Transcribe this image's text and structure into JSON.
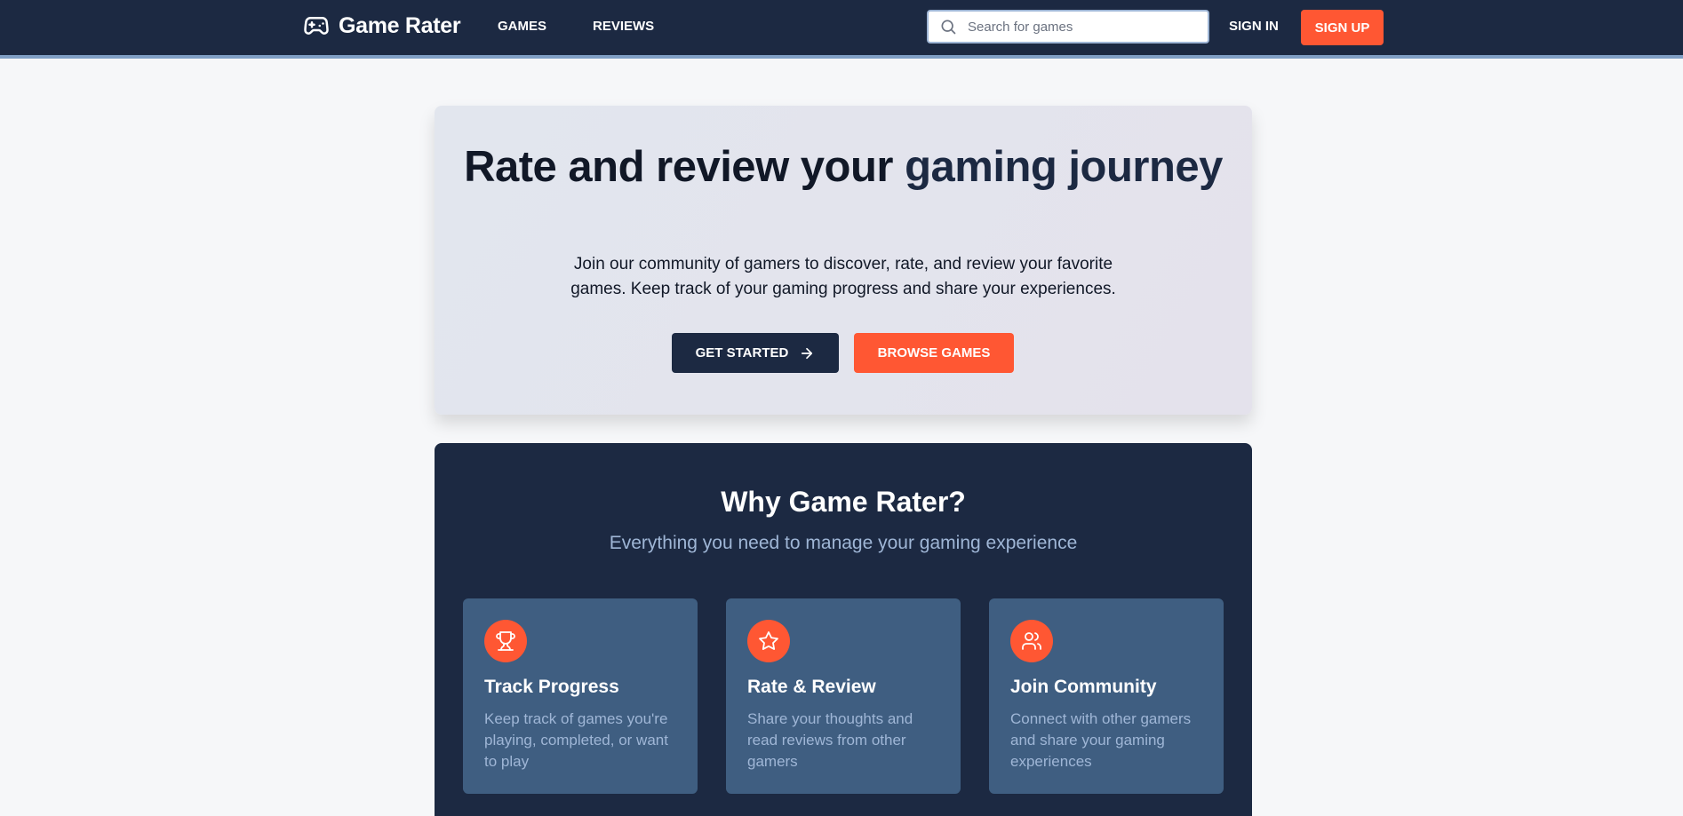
{
  "nav": {
    "brand": "Game Rater",
    "links": [
      "GAMES",
      "REVIEWS"
    ],
    "search_placeholder": "Search for games",
    "sign_in": "SIGN IN",
    "sign_up": "SIGN UP"
  },
  "hero": {
    "title_part1": "Rate and review your ",
    "title_accent": "gaming journey",
    "description": "Join our community of gamers to discover, rate, and review your favorite games. Keep track of your gaming progress and share your experiences.",
    "primary_button": "GET STARTED",
    "secondary_button": "BROWSE GAMES"
  },
  "features": {
    "title": "Why Game Rater?",
    "subtitle": "Everything you need to manage your gaming experience",
    "cards": [
      {
        "icon": "trophy-icon",
        "title": "Track Progress",
        "description": "Keep track of games you're playing, completed, or want to play"
      },
      {
        "icon": "star-icon",
        "title": "Rate & Review",
        "description": "Share your thoughts and read reviews from other gamers"
      },
      {
        "icon": "users-icon",
        "title": "Join Community",
        "description": "Connect with other gamers and share your gaming experiences"
      }
    ]
  },
  "colors": {
    "navy": "#1c2942",
    "accent_orange": "#ff5733",
    "card_blue": "#3f5e81",
    "muted_text": "#9fb6d6"
  }
}
